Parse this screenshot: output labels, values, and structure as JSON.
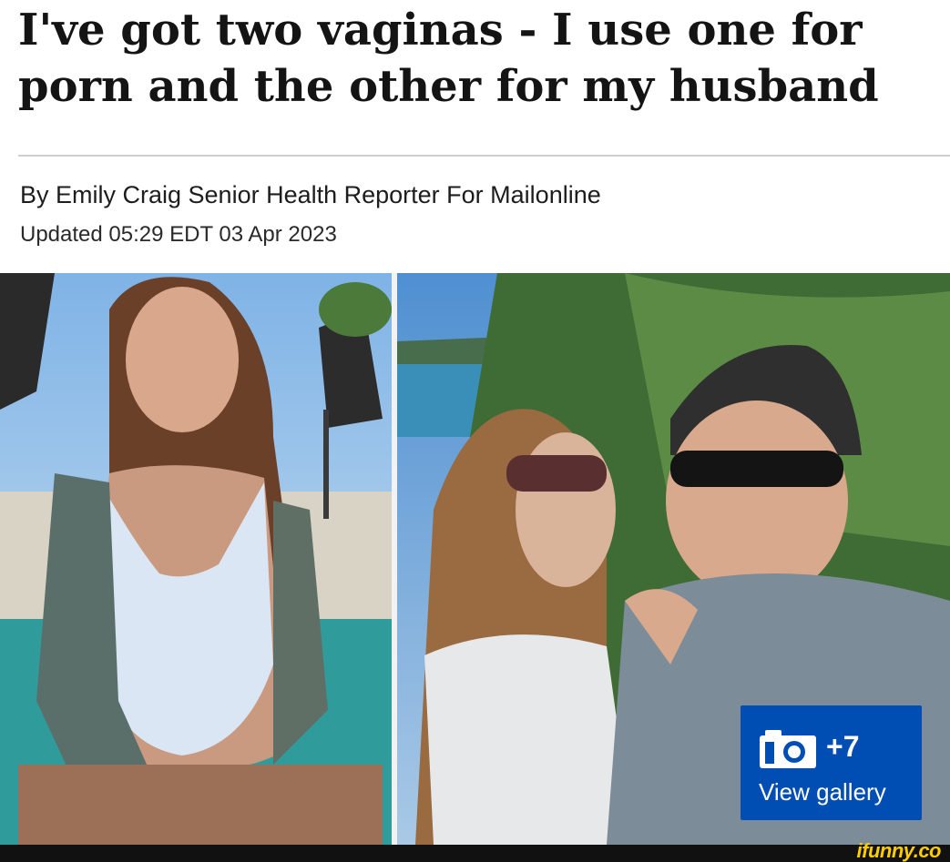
{
  "article": {
    "headline": "I've got two vaginas - I use one for porn and the other for my husband",
    "byline": "By Emily Craig Senior Health Reporter For Mailonline",
    "updated": "Updated 05:29 EDT 03 Apr 2023"
  },
  "gallery": {
    "icon": "camera-icon",
    "count": "+7",
    "label": "View gallery",
    "color": "#004db3"
  },
  "watermark": {
    "text": "ifunny.co",
    "color": "#ffcc00"
  }
}
